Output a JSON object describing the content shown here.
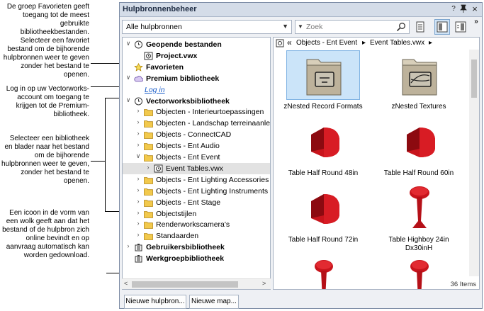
{
  "callouts": {
    "favorites": "De groep Favorieten geeft toegang tot de meest gebruikte bibliotheekbestanden. Selecteer een favoriet bestand om de bijhorende hulpbronnen weer te geven zonder het bestand te openen.",
    "login": "Log in op uw Vectorworks-account om toegang te krijgen tot de Premium-bibliotheek.",
    "browse": "Selecteer een bibliotheek en blader naar het bestand om de bijhorende hulpbronnen weer te geven, zonder het bestand te openen.",
    "cloud": "Een icoon in de vorm van een wolk geeft aan dat het bestand of de hulpbron zich online bevindt en op aanvraag automatisch kan worden gedownload."
  },
  "window": {
    "title": "Hulpbronnenbeheer",
    "pin_label": "?",
    "dock_label": "↑",
    "close_label": "×",
    "expand_label": "»"
  },
  "toolbar": {
    "filter_value": "Alle hulpbronnen",
    "search_placeholder": "Zoek"
  },
  "tree": {
    "items": [
      {
        "label": "Geopende bestanden",
        "bold": true,
        "chev": "∨",
        "icon": "clock",
        "indent": 0
      },
      {
        "label": "Project.vwx",
        "bold": true,
        "chev": "",
        "icon": "vwx",
        "indent": 1
      },
      {
        "label": "Favorieten",
        "bold": true,
        "chev": "",
        "icon": "star",
        "indent": 0
      },
      {
        "label": "Premium bibliotheek",
        "bold": true,
        "chev": "∨",
        "icon": "cloud",
        "indent": 0
      },
      {
        "label": "Log in",
        "bold": false,
        "link": true,
        "chev": "",
        "icon": "",
        "indent": 1
      },
      {
        "label": "Vectorworksbibliotheek",
        "bold": true,
        "chev": "∨",
        "icon": "clock",
        "indent": 0
      },
      {
        "label": "Objecten - Interieurtoepassingen",
        "bold": false,
        "chev": "›",
        "icon": "folder",
        "indent": 1
      },
      {
        "label": "Objecten - Landschap terreinaanleg",
        "bold": false,
        "chev": "›",
        "icon": "folder",
        "indent": 1
      },
      {
        "label": "Objects - ConnectCAD",
        "bold": false,
        "chev": "›",
        "icon": "folder",
        "indent": 1
      },
      {
        "label": "Objects - Ent Audio",
        "bold": false,
        "chev": "›",
        "icon": "folder",
        "indent": 1
      },
      {
        "label": "Objects - Ent Event",
        "bold": false,
        "chev": "∨",
        "icon": "folder",
        "indent": 1
      },
      {
        "label": "Event Tables.vwx",
        "bold": false,
        "chev": "›",
        "icon": "vwx",
        "indent": 2,
        "selected": true
      },
      {
        "label": "Objects - Ent Lighting Accessories",
        "bold": false,
        "chev": "›",
        "icon": "folder",
        "indent": 1
      },
      {
        "label": "Objects - Ent Lighting Instruments",
        "bold": false,
        "chev": "›",
        "icon": "folder",
        "indent": 1
      },
      {
        "label": "Objects - Ent Stage",
        "bold": false,
        "chev": "›",
        "icon": "folder",
        "indent": 1
      },
      {
        "label": "Objectstijlen",
        "bold": false,
        "chev": "›",
        "icon": "folder",
        "indent": 1
      },
      {
        "label": "Renderworkscamera's",
        "bold": false,
        "chev": "›",
        "icon": "folder",
        "indent": 1
      },
      {
        "label": "Standaarden",
        "bold": false,
        "chev": "›",
        "icon": "folder",
        "indent": 1
      },
      {
        "label": "Gebruikersbibliotheek",
        "bold": true,
        "chev": "›",
        "icon": "building",
        "indent": 0
      },
      {
        "label": "Werkgroepbibliotheek",
        "bold": true,
        "chev": "",
        "icon": "building",
        "indent": 0
      }
    ]
  },
  "pathbar": {
    "back": "«",
    "crumb1": "Objects - Ent Event",
    "sep": "▸",
    "crumb2": "Event Tables.vwx",
    "end": "▸"
  },
  "resources": [
    {
      "caption": "zNested Record Formats",
      "kind": "folder-record",
      "selected": true
    },
    {
      "caption": "zNested Textures",
      "kind": "folder-texture",
      "selected": false
    },
    {
      "caption": "Table Half Round 48in",
      "kind": "half-round",
      "selected": false
    },
    {
      "caption": "Table Half Round 60in",
      "kind": "half-round",
      "selected": false
    },
    {
      "caption": "Table Half Round 72in",
      "kind": "half-round-72",
      "selected": false
    },
    {
      "caption": "Table Highboy 24in Dx30inH",
      "kind": "highboy",
      "selected": false
    },
    {
      "caption": "",
      "kind": "pedestal",
      "selected": false
    },
    {
      "caption": "",
      "kind": "pedestal",
      "selected": false
    }
  ],
  "status": {
    "count": "36 Items"
  },
  "buttons": {
    "new_resource": "Nieuwe hulpbron...",
    "new_folder": "Nieuwe map..."
  },
  "colors": {
    "accent_red": "#c8141c",
    "folder_yellow": "#f2c94c",
    "selection_blue": "#cbe4f9"
  }
}
